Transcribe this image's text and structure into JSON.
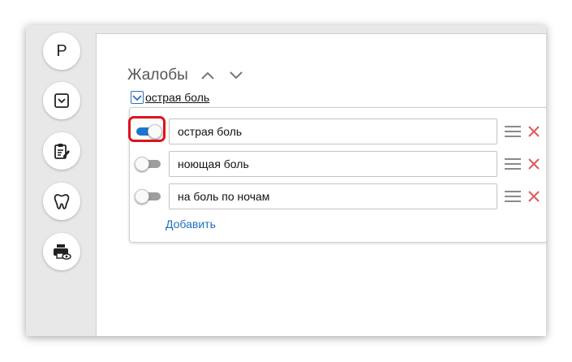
{
  "sidebar": {
    "items": [
      {
        "type": "letter",
        "label": "P",
        "name": "sidebar-item-profile"
      },
      {
        "type": "icon",
        "icon": "chevron-box-icon",
        "name": "sidebar-item-collapse"
      },
      {
        "type": "icon",
        "icon": "clipboard-edit-icon",
        "name": "sidebar-item-notes"
      },
      {
        "type": "icon",
        "icon": "tooth-icon",
        "name": "sidebar-item-dental"
      },
      {
        "type": "icon",
        "icon": "print-preview-icon",
        "name": "sidebar-item-print"
      }
    ]
  },
  "section": {
    "title": "Жалобы",
    "selected_summary": "острая боль"
  },
  "complaints": [
    {
      "value": "острая боль",
      "enabled": true
    },
    {
      "value": "ноющая боль",
      "enabled": false
    },
    {
      "value": "на боль по ночам",
      "enabled": false
    }
  ],
  "add_label": "Добавить",
  "colors": {
    "accent": "#1976d2",
    "delete": "#e05a5a",
    "highlight": "#e0121b",
    "link": "#1f6fbf"
  }
}
